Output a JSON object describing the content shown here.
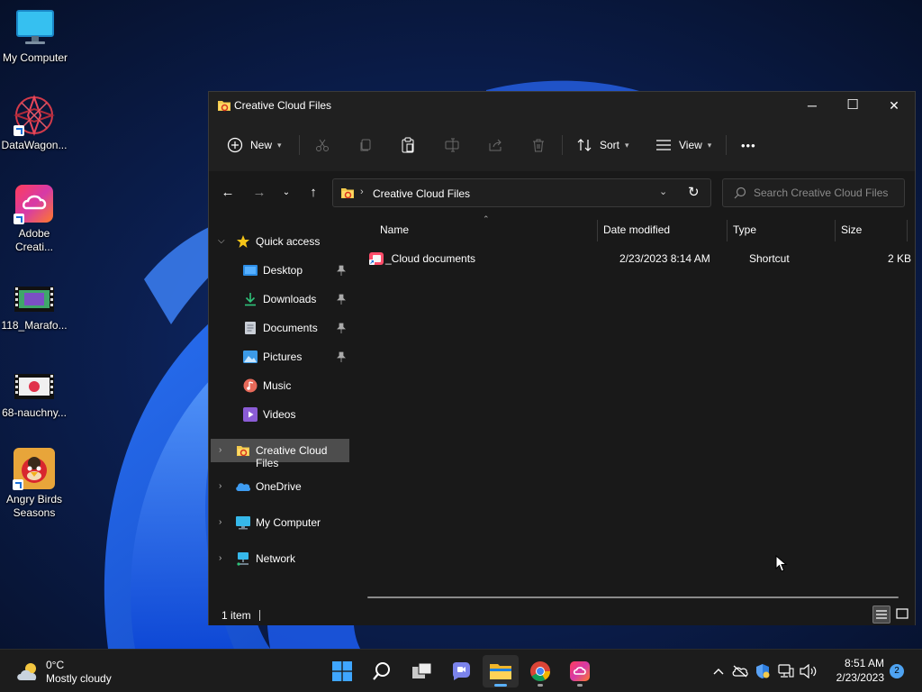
{
  "desktop": {
    "icons": [
      {
        "label": "My Computer",
        "icon": "monitor-icon"
      },
      {
        "label": "DataWagon...",
        "icon": "datawagon-icon"
      },
      {
        "label": "Adobe Creati...",
        "icon": "adobe-cc-icon"
      },
      {
        "label": "118_Marafo...",
        "icon": "video-file-icon"
      },
      {
        "label": "68-nauchny...",
        "icon": "video-file-icon"
      },
      {
        "label": "Angry Birds Seasons",
        "icon": "angry-birds-icon"
      }
    ]
  },
  "window": {
    "title": "Creative Cloud Files",
    "controls": {
      "minimize": "─",
      "maximize": "☐",
      "close": "✕"
    },
    "toolbar": {
      "new_label": "New",
      "sort_label": "Sort",
      "view_label": "View",
      "more_label": "•••"
    },
    "address": {
      "path": "Creative Cloud Files",
      "search_placeholder": "Search Creative Cloud Files"
    },
    "nav_pane": {
      "quick_access": "Quick access",
      "quick_items": [
        {
          "label": "Desktop",
          "icon": "desktop-folder-icon",
          "pinned": true
        },
        {
          "label": "Downloads",
          "icon": "downloads-icon",
          "pinned": true
        },
        {
          "label": "Documents",
          "icon": "documents-icon",
          "pinned": true
        },
        {
          "label": "Pictures",
          "icon": "pictures-icon",
          "pinned": true
        },
        {
          "label": "Music",
          "icon": "music-icon",
          "pinned": false
        },
        {
          "label": "Videos",
          "icon": "videos-icon",
          "pinned": false
        }
      ],
      "creative_cloud": "Creative Cloud Files",
      "onedrive": "OneDrive",
      "my_computer": "My Computer",
      "network": "Network"
    },
    "columns": {
      "name": "Name",
      "date": "Date modified",
      "type": "Type",
      "size": "Size"
    },
    "files": [
      {
        "name": "_Cloud documents",
        "date": "2/23/2023 8:14 AM",
        "type": "Shortcut",
        "size": "2 KB"
      }
    ],
    "status": {
      "count": "1 item"
    }
  },
  "taskbar": {
    "weather": {
      "temp": "0°C",
      "condition": "Mostly cloudy"
    },
    "clock": {
      "time": "8:51 AM",
      "date": "2/23/2023"
    },
    "notifications": "2"
  },
  "colors": {
    "accent": "#0078d4",
    "window_bg": "#191919",
    "titlebar_bg": "#202020",
    "selected_bg": "#4d4d4d",
    "taskbar_bg": "#1c1c1c"
  }
}
